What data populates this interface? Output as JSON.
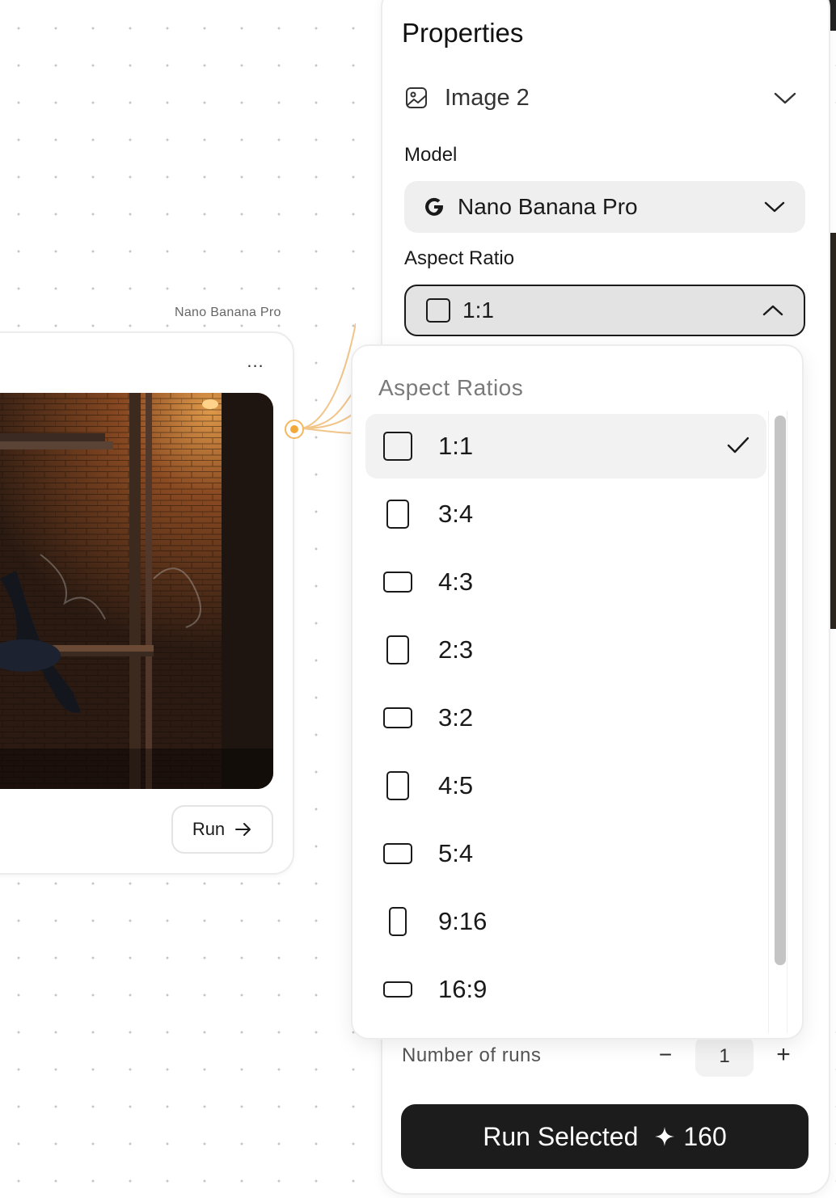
{
  "canvas": {
    "node_label": "Nano Banana Pro",
    "node_menu_label": "...",
    "run_button_label": "Run"
  },
  "properties": {
    "title": "Properties",
    "node_name": "Image 2",
    "model_label": "Model",
    "model_value": "Nano Banana Pro",
    "aspect_label": "Aspect Ratio",
    "aspect_value": "1:1",
    "runs_label": "Number of runs",
    "runs_value": "1",
    "runs_minus": "−",
    "runs_plus": "+",
    "run_selected_label": "Run Selected",
    "run_selected_cost": "160"
  },
  "dropdown": {
    "title": "Aspect Ratios",
    "selected": "1:1",
    "items": [
      {
        "label": "1:1",
        "shape": "square"
      },
      {
        "label": "3:4",
        "shape": "portrait"
      },
      {
        "label": "4:3",
        "shape": "landscape"
      },
      {
        "label": "2:3",
        "shape": "portrait"
      },
      {
        "label": "3:2",
        "shape": "landscape"
      },
      {
        "label": "4:5",
        "shape": "portrait"
      },
      {
        "label": "5:4",
        "shape": "landscape"
      },
      {
        "label": "9:16",
        "shape": "tall"
      },
      {
        "label": "16:9",
        "shape": "wide"
      }
    ]
  },
  "colors": {
    "accent_port": "#f2a93b",
    "button_dark": "#1c1c1c"
  },
  "icons": {
    "image": "image-icon",
    "model_brand": "google-g-icon",
    "chevron": "chevron-down-icon",
    "check": "check-icon",
    "sparkle": "sparkle-icon",
    "arrow": "arrow-right-icon"
  }
}
